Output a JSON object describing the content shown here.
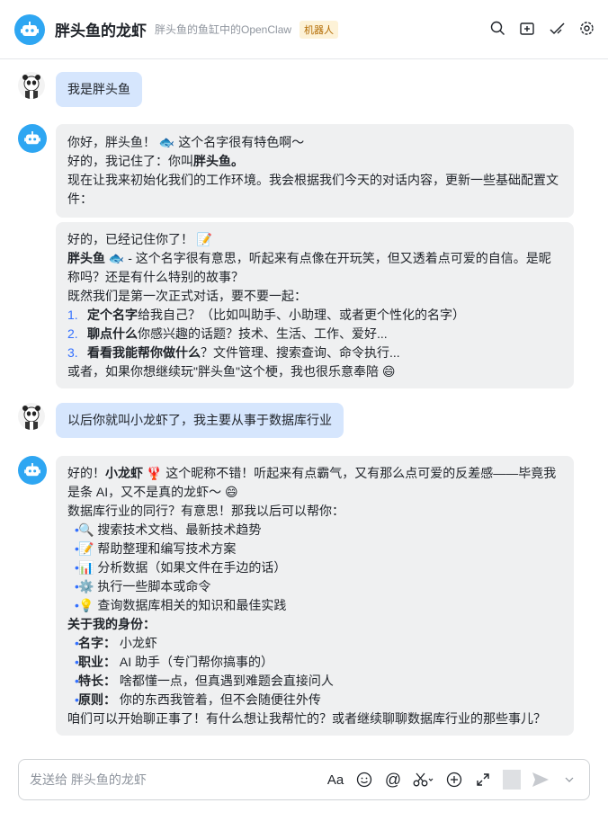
{
  "header": {
    "title": "胖头鱼的龙虾",
    "subtitle": "胖头鱼的鱼缸中的OpenClaw",
    "badge": "机器人"
  },
  "messages": {
    "m1": {
      "text": "我是胖头鱼"
    },
    "m2": {
      "l1a": "你好，胖头鱼！",
      "l1b": "这个名字很有特色啊～",
      "l2a": "好的，我记住了：你叫",
      "l2b": "胖头鱼。",
      "l3": "现在让我来初始化我们的工作环境。我会根据我们今天的对话内容，更新一些基础配置文件：",
      "s_l1": "好的，已经记住你了！",
      "s_l2a": "胖头鱼",
      "s_l2b": "- 这个名字很有意思，听起来有点像在开玩笑，但又透着点可爱的自信。是昵称吗？还是有什么特别的故事？",
      "s_l3": "既然我们是第一次正式对话，要不要一起：",
      "items": [
        {
          "num": "1.",
          "bold": "定个名字",
          "rest": "给我自己？（比如叫助手、小助理、或者更个性化的名字）"
        },
        {
          "num": "2.",
          "bold": "聊点什么",
          "rest": "你感兴趣的话题？技术、生活、工作、爱好..."
        },
        {
          "num": "3.",
          "bold": "看看我能帮你做什么",
          "rest": "？文件管理、搜索查询、命令执行..."
        }
      ],
      "s_end": "或者，如果你想继续玩\"胖头鱼\"这个梗，我也很乐意奉陪"
    },
    "m3": {
      "text": "以后你就叫小龙虾了，我主要从事于数据库行业"
    },
    "m4": {
      "l1a": "好的！",
      "l1b": "小龙虾",
      "l1c": "这个昵称不错！听起来有点霸气，又有那么点可爱的反差感——毕竟我是条 AI，又不是真的龙虾～",
      "l2": "数据库行业的同行？有意思！那我以后可以帮你：",
      "help": [
        {
          "icon": "🔍",
          "text": "搜索技术文档、最新技术趋势"
        },
        {
          "icon": "📝",
          "text": "帮助整理和编写技术方案"
        },
        {
          "icon": "📊",
          "text": "分析数据（如果文件在手边的话）"
        },
        {
          "icon": "⚙️",
          "text": "执行一些脚本或命令"
        },
        {
          "icon": "💡",
          "text": "查询数据库相关的知识和最佳实践"
        }
      ],
      "identity_title": "关于我的身份：",
      "identity": [
        {
          "k": "名字：",
          "v": "小龙虾"
        },
        {
          "k": "职业：",
          "v": "AI 助手（专门帮你搞事的）"
        },
        {
          "k": "特长：",
          "v": "啥都懂一点，但真遇到难题会直接问人"
        },
        {
          "k": "原则：",
          "v": "你的东西我管着，但不会随便往外传"
        }
      ],
      "end": "咱们可以开始聊正事了！有什么想让我帮忙的？或者继续聊聊数据库行业的那些事儿？"
    }
  },
  "composer": {
    "placeholder": "发送给 胖头鱼的龙虾",
    "font_tool": "Aa"
  },
  "colors": {
    "accent": "#3370ff",
    "user_bubble": "#d6e6fd",
    "bot_bubble": "#eff0f1",
    "bot_avatar": "#2ea6f2"
  }
}
